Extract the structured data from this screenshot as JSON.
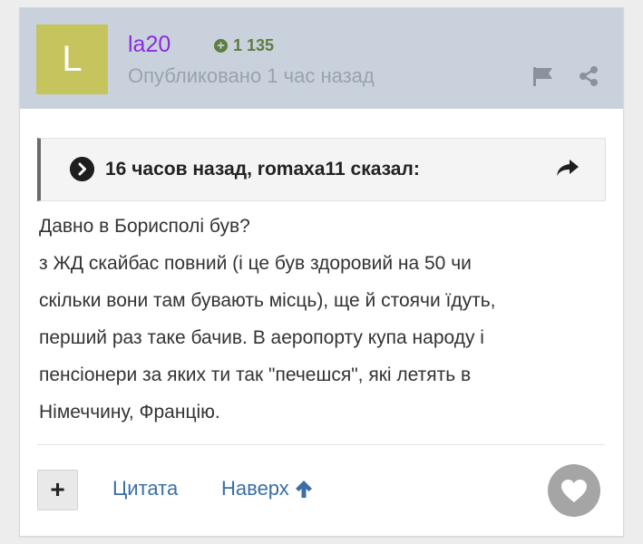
{
  "post": {
    "avatar_letter": "L",
    "avatar_color": "#c6c45c",
    "username": "la20",
    "reputation": "1 135",
    "posted": "Опубликовано 1 час назад",
    "icons": [
      "flag-icon",
      "share-icon"
    ]
  },
  "quote": {
    "header": "16 часов назад, romaxa11 сказал:",
    "icons": [
      "chevron-right-circle-icon",
      "share-arrow-icon"
    ]
  },
  "content": {
    "text": "Давно в Борисполі був?\nз ЖД скайбас повний (і це був здоровий на 50 чи\nскільки вони там бувають місць), ще й стоячи їдуть,\nперший раз таке бачив. В аеропорту купа народу і\nпенсіонери за яких ти так \"печешся\", які летять в\nНімеччину, Францію."
  },
  "footer": {
    "plus_label": "+",
    "quote_label": "Цитата",
    "up_label": "Наверх",
    "icons": [
      "arrow-up-icon",
      "heart-icon"
    ]
  },
  "colors": {
    "header_bg": "#c9d2dc",
    "username": "#8a2be2",
    "reputation": "#5f7d40",
    "link": "#3b6ea5"
  }
}
